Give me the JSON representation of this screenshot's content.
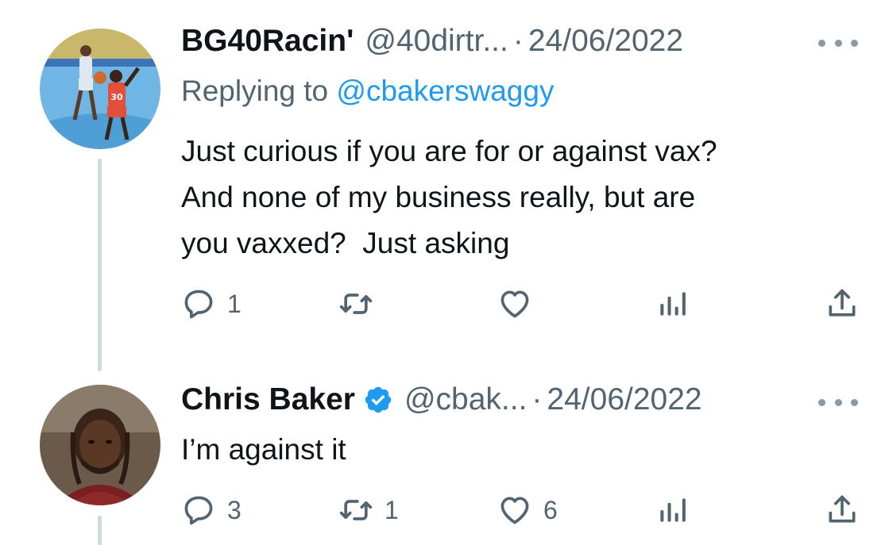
{
  "tweets": [
    {
      "name": "BG40Racin'",
      "handle": "@40dirtr...",
      "separator": "·",
      "date": "24/06/2022",
      "replying_prefix": "Replying to",
      "replying_to": "@cbakerswaggy",
      "text_lines": [
        "Just curious if you are for or against vax?",
        "And none of my business really, but are",
        "you vaxxed?  Just asking"
      ],
      "avatar_jersey": "30",
      "counts": {
        "replies": "1",
        "retweets": "",
        "likes": ""
      }
    },
    {
      "name": "Chris Baker",
      "verified": true,
      "handle": "@cbak...",
      "separator": "·",
      "date": "24/06/2022",
      "text_lines": [
        "I’m against it"
      ],
      "counts": {
        "replies": "3",
        "retweets": "1",
        "likes": "6"
      }
    }
  ],
  "icons": {
    "reply": "speech-bubble-icon",
    "retweet": "retweet-arrows-icon",
    "like": "heart-icon",
    "views": "bar-chart-icon",
    "share": "share-upload-icon",
    "more": "more-horizontal-icon",
    "verified": "verified-badge-icon"
  },
  "colors": {
    "link": "#1d9bf0",
    "secondary_text": "#536471",
    "thread_line": "#cfd9de",
    "verified": "#1d9bf0"
  }
}
